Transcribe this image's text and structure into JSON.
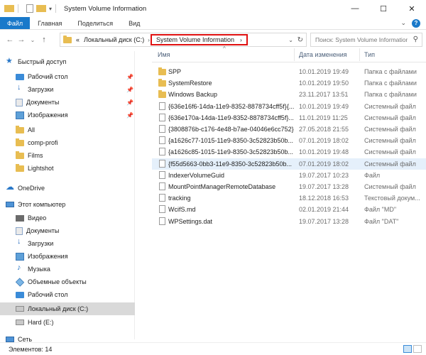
{
  "window": {
    "title": "System Volume Information",
    "controls": {
      "minimize": "—",
      "maximize": "☐",
      "close": "✕"
    }
  },
  "ribbon": {
    "tabs": [
      "Файл",
      "Главная",
      "Поделиться",
      "Вид"
    ],
    "expand": "⌄",
    "help": "?"
  },
  "nav": {
    "back": "←",
    "forward": "→",
    "recent": "⌄",
    "up": "↑"
  },
  "address": {
    "prefix": "«",
    "drive": "Локальный диск (C:)",
    "current": "System Volume Information",
    "separator": "›",
    "dropdown": "⌄",
    "refresh": "↻"
  },
  "search": {
    "placeholder": "Поиск: System Volume Information",
    "icon": "search-icon"
  },
  "sidebar": {
    "quick_access": "Быстрый доступ",
    "items": [
      {
        "label": "Рабочий стол",
        "icon": "desktop-icon",
        "pinned": true
      },
      {
        "label": "Загрузки",
        "icon": "downloads-icon",
        "pinned": true
      },
      {
        "label": "Документы",
        "icon": "documents-icon",
        "pinned": true
      },
      {
        "label": "Изображения",
        "icon": "pictures-icon",
        "pinned": true
      },
      {
        "label": "All",
        "icon": "folder-icon"
      },
      {
        "label": "comp-profi",
        "icon": "folder-icon"
      },
      {
        "label": "Films",
        "icon": "folder-icon"
      },
      {
        "label": "Lightshot",
        "icon": "folder-icon"
      }
    ],
    "onedrive": "OneDrive",
    "this_pc": "Этот компьютер",
    "pc_items": [
      {
        "label": "Видео",
        "icon": "videos-icon"
      },
      {
        "label": "Документы",
        "icon": "documents-icon"
      },
      {
        "label": "Загрузки",
        "icon": "downloads-icon"
      },
      {
        "label": "Изображения",
        "icon": "pictures-icon"
      },
      {
        "label": "Музыка",
        "icon": "music-icon"
      },
      {
        "label": "Объемные объекты",
        "icon": "3d-objects-icon"
      },
      {
        "label": "Рабочий стол",
        "icon": "desktop-icon"
      },
      {
        "label": "Локальный диск (C:)",
        "icon": "drive-icon",
        "selected": true
      },
      {
        "label": "Hard (E:)",
        "icon": "drive-icon"
      }
    ],
    "network": "Сеть"
  },
  "columns": {
    "name": "Имя",
    "date": "Дата изменения",
    "type": "Тип",
    "sort": "^"
  },
  "files": [
    {
      "name": "SPP",
      "date": "10.01.2019 19:49",
      "type": "Папка с файлами",
      "kind": "folder"
    },
    {
      "name": "SystemRestore",
      "date": "10.01.2019 19:50",
      "type": "Папка с файлами",
      "kind": "folder"
    },
    {
      "name": "Windows Backup",
      "date": "23.11.2017 13:51",
      "type": "Папка с файлами",
      "kind": "folder"
    },
    {
      "name": "{636e16f6-14da-11e9-8352-8878734cff5f}{...",
      "date": "10.01.2019 19:49",
      "type": "Системный файл",
      "kind": "file"
    },
    {
      "name": "{636e170a-14da-11e9-8352-8878734cff5f}...",
      "date": "11.01.2019 11:25",
      "type": "Системный файл",
      "kind": "file"
    },
    {
      "name": "{3808876b-c176-4e48-b7ae-04046e6cc752}",
      "date": "27.05.2018 21:55",
      "type": "Системный файл",
      "kind": "file"
    },
    {
      "name": "{a1626c77-1015-11e9-8350-3c52823b50b...",
      "date": "07.01.2019 18:02",
      "type": "Системный файл",
      "kind": "file"
    },
    {
      "name": "{a1626c85-1015-11e9-8350-3c52823b50b...",
      "date": "10.01.2019 19:48",
      "type": "Системный файл",
      "kind": "file"
    },
    {
      "name": "{f55d5663-0bb3-11e9-8350-3c52823b50b...",
      "date": "07.01.2019 18:02",
      "type": "Системный файл",
      "kind": "file",
      "selected": true
    },
    {
      "name": "IndexerVolumeGuid",
      "date": "19.07.2017 10:23",
      "type": "Файл",
      "kind": "file"
    },
    {
      "name": "MountPointManagerRemoteDatabase",
      "date": "19.07.2017 13:28",
      "type": "Системный файл",
      "kind": "file"
    },
    {
      "name": "tracking",
      "date": "18.12.2018 16:53",
      "type": "Текстовый докум...",
      "kind": "file"
    },
    {
      "name": "WcifS.md",
      "date": "02.01.2019 21:44",
      "type": "Файл \"MD\"",
      "kind": "file"
    },
    {
      "name": "WPSettings.dat",
      "date": "19.07.2017 13:28",
      "type": "Файл \"DAT\"",
      "kind": "file"
    }
  ],
  "status": {
    "count": "Элементов: 14"
  },
  "colors": {
    "accent": "#1979ca",
    "highlight_border": "#e01010",
    "selected_row": "#e5f0fb",
    "folder": "#e8bd52"
  }
}
